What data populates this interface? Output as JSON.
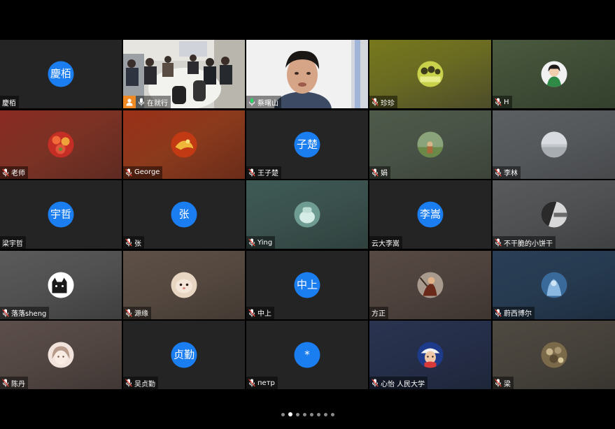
{
  "participants": [
    {
      "name": "慶栢",
      "avatar_text": "慶栢",
      "mic": "none"
    },
    {
      "name": "在就行",
      "mic": "on",
      "video": true,
      "host": true
    },
    {
      "name": "蔡曙山",
      "mic": "active",
      "video": true,
      "speaking": true
    },
    {
      "name": "珍珍",
      "mic": "muted"
    },
    {
      "name": "H",
      "mic": "muted"
    },
    {
      "name": "老师",
      "mic": "muted"
    },
    {
      "name": "George",
      "mic": "muted"
    },
    {
      "name": "王子楚",
      "avatar_text": "子楚",
      "mic": "muted"
    },
    {
      "name": "娟",
      "mic": "muted"
    },
    {
      "name": "李林",
      "mic": "muted"
    },
    {
      "name": "梁宇哲",
      "avatar_text": "宇哲",
      "mic": "none"
    },
    {
      "name": "张",
      "avatar_text": "张",
      "mic": "muted"
    },
    {
      "name": "Ying",
      "mic": "muted"
    },
    {
      "name": "云大李嵩",
      "avatar_text": "李嵩",
      "mic": "none"
    },
    {
      "name": "不干脆的小饼干",
      "mic": "muted"
    },
    {
      "name": "落落sheng",
      "mic": "muted"
    },
    {
      "name": "源缘",
      "mic": "muted"
    },
    {
      "name": "中上",
      "avatar_text": "中上",
      "mic": "muted"
    },
    {
      "name": "方正",
      "mic": "none"
    },
    {
      "name": "蔚西博尔",
      "mic": "muted"
    },
    {
      "name": "陈丹",
      "mic": "muted"
    },
    {
      "name": "吴贞勤",
      "avatar_text": "贞勤",
      "mic": "muted"
    },
    {
      "name": "петр",
      "avatar_text": "*",
      "mic": "muted"
    },
    {
      "name": "心怡 人民大学",
      "mic": "muted"
    },
    {
      "name": "梁",
      "mic": "muted"
    }
  ],
  "pagination": {
    "pages": 8,
    "current": 2
  },
  "colors": {
    "avatar_blue": "#1a7df0",
    "speaking_border": "#2fd36b",
    "host_badge": "#f08a24",
    "muted_mic": "#e0453a"
  },
  "icons": {
    "muted": "mic-muted-icon",
    "on": "mic-icon",
    "active": "mic-active-icon",
    "host": "host-icon"
  }
}
